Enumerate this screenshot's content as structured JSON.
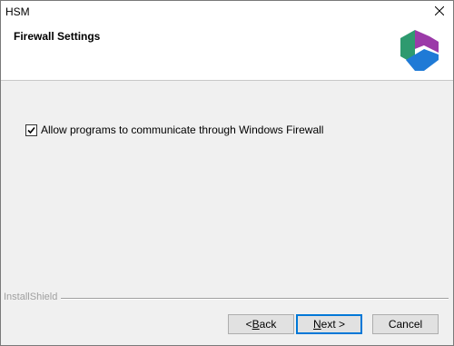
{
  "window": {
    "title": "HSM"
  },
  "header": {
    "title": "Firewall Settings",
    "logo_colors": [
      "#2e9a6f",
      "#a03aa0",
      "#1f7ad6"
    ]
  },
  "options": {
    "firewall_checkbox_label": "Allow programs to communicate through Windows Firewall",
    "firewall_checked": true
  },
  "footer": {
    "brand_label": "InstallShield"
  },
  "buttons": {
    "back_prefix": "< ",
    "back_mnemonic": "B",
    "back_rest": "ack",
    "next_mnemonic": "N",
    "next_rest": "ext >",
    "cancel_label": "Cancel"
  },
  "icons": {
    "close": "close-icon",
    "checkmark": "checkmark-icon",
    "logo": "app-logo-icon"
  }
}
